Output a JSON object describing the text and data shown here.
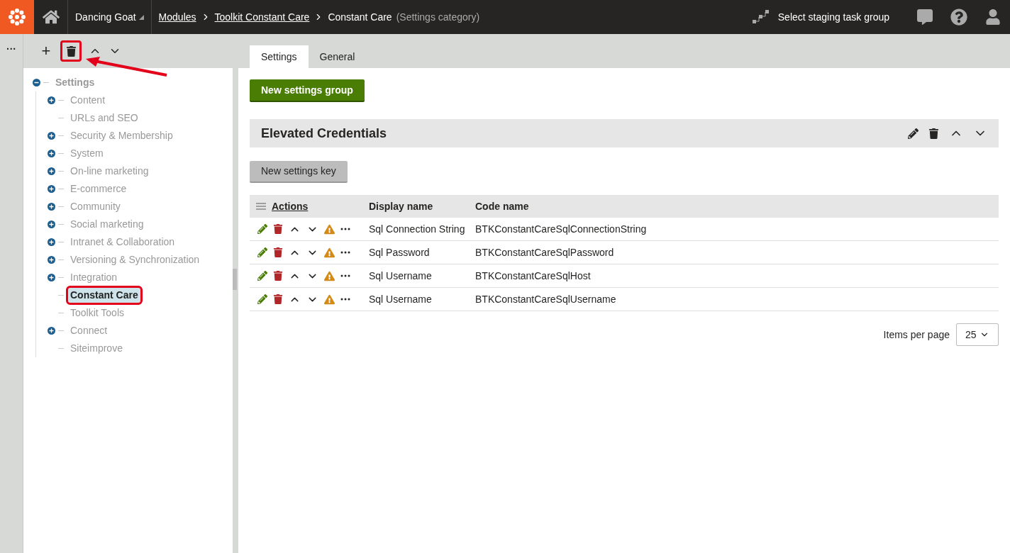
{
  "header": {
    "site": "Dancing Goat",
    "breadcrumbs": [
      {
        "label": "Modules",
        "link": true
      },
      {
        "label": "Toolkit Constant Care",
        "link": true
      },
      {
        "label": "Constant Care",
        "link": false
      }
    ],
    "category_note": "(Settings category)",
    "staging": "Select staging task group"
  },
  "side_strip": {
    "menu": "···"
  },
  "tree_toolbar": {
    "add": "+",
    "delete_annotated": true
  },
  "tree": [
    {
      "label": "Settings",
      "kind": "expandable",
      "expanded": true,
      "selected": false,
      "annotated": false,
      "children": [
        {
          "label": "Content",
          "kind": "expandable",
          "expanded": false,
          "selected": false,
          "annotated": false
        },
        {
          "label": "URLs and SEO",
          "kind": "leaf",
          "selected": false,
          "annotated": false
        },
        {
          "label": "Security & Membership",
          "kind": "expandable",
          "expanded": false,
          "selected": false,
          "annotated": false
        },
        {
          "label": "System",
          "kind": "expandable",
          "expanded": false,
          "selected": false,
          "annotated": false
        },
        {
          "label": "On-line marketing",
          "kind": "expandable",
          "expanded": false,
          "selected": false,
          "annotated": false
        },
        {
          "label": "E-commerce",
          "kind": "expandable",
          "expanded": false,
          "selected": false,
          "annotated": false
        },
        {
          "label": "Community",
          "kind": "expandable",
          "expanded": false,
          "selected": false,
          "annotated": false
        },
        {
          "label": "Social marketing",
          "kind": "expandable",
          "expanded": false,
          "selected": false,
          "annotated": false
        },
        {
          "label": "Intranet & Collaboration",
          "kind": "expandable",
          "expanded": false,
          "selected": false,
          "annotated": false
        },
        {
          "label": "Versioning & Synchronization",
          "kind": "expandable",
          "expanded": false,
          "selected": false,
          "annotated": false
        },
        {
          "label": "Integration",
          "kind": "expandable",
          "expanded": false,
          "selected": false,
          "annotated": false
        },
        {
          "label": "Constant Care",
          "kind": "leaf",
          "selected": true,
          "annotated": true
        },
        {
          "label": "Toolkit Tools",
          "kind": "leaf",
          "selected": false,
          "annotated": false
        },
        {
          "label": "Connect",
          "kind": "expandable",
          "expanded": false,
          "selected": false,
          "annotated": false
        },
        {
          "label": "Siteimprove",
          "kind": "leaf",
          "selected": false,
          "annotated": false
        }
      ]
    }
  ],
  "tabs": [
    {
      "label": "Settings",
      "selected": true
    },
    {
      "label": "General",
      "selected": false
    }
  ],
  "new_group_button": "New settings group",
  "group": {
    "title": "Elevated Credentials",
    "new_key_button": "New settings key",
    "columns": [
      "Actions",
      "Display name",
      "Code name"
    ],
    "rows": [
      {
        "display_name": "Sql Connection String",
        "code_name": "BTKConstantCareSqlConnectionString"
      },
      {
        "display_name": "Sql Password",
        "code_name": "BTKConstantCareSqlPassword"
      },
      {
        "display_name": "Sql Username",
        "code_name": "BTKConstantCareSqlHost"
      },
      {
        "display_name": "Sql Username",
        "code_name": "BTKConstantCareSqlUsername"
      }
    ]
  },
  "pager": {
    "label": "Items per page",
    "value": "25"
  }
}
